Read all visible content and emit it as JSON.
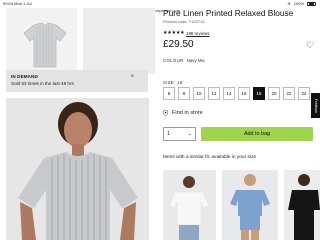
{
  "status": {
    "time": "09:04",
    "date": "Mon 1 Jul",
    "battery": "100%"
  },
  "url": "marksandspencer.com",
  "in_demand": {
    "title": "IN DEMAND",
    "text": "Sold 53 times in the last 48 hrs",
    "close": "×"
  },
  "product": {
    "title": "Pure Linen Printed Relaxed Blouse",
    "code": "Product code: T120713",
    "rating_stars": "★★★★★",
    "reviews": "188 reviews",
    "price": "£29.50",
    "colour_label": "COLOUR",
    "colour_value": "Navy Mix",
    "size_label": "SIZE: 18",
    "sizes": [
      "6",
      "8",
      "10",
      "12",
      "14",
      "16",
      "18",
      "20",
      "22",
      "24"
    ],
    "selected_size": "18",
    "find_in_store": "Find in store",
    "qty_value": "1",
    "add_to_bag": "Add to bag"
  },
  "feedback_tab": "Feedback",
  "similar": {
    "title": "Items with a similar fit, available in your size"
  },
  "icons": [
    "heart-icon",
    "map-pin-icon",
    "close-icon",
    "chevron-down-icon"
  ],
  "colors": {
    "add_to_bag": "#9fd54c",
    "selected_size": "#111111",
    "in_demand_bg": "#e3e3e3"
  }
}
